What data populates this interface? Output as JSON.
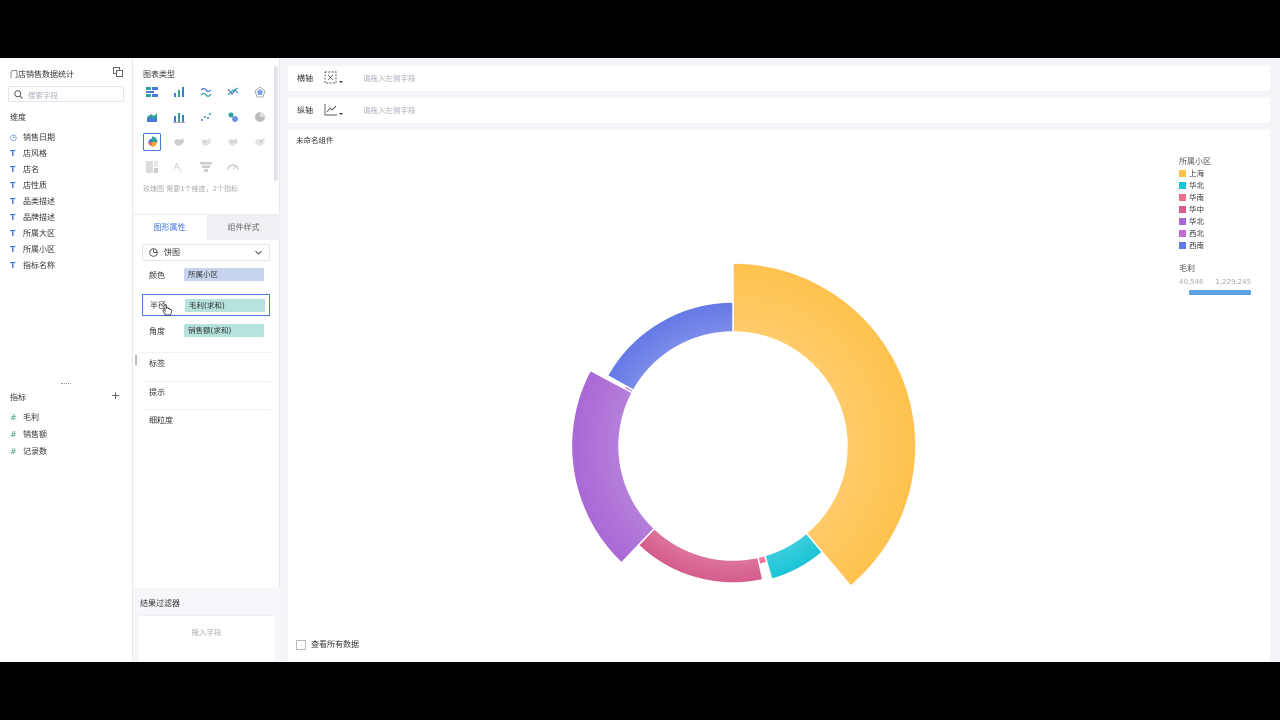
{
  "fields_panel": {
    "dataset_title": "门店销售数据统计",
    "search_placeholder": "搜索字段",
    "dimensions_title": "维度",
    "dimensions": [
      {
        "icon": "date-icon",
        "label": "销售日期"
      },
      {
        "icon": "text-field-icon",
        "label": "店风格"
      },
      {
        "icon": "text-field-icon",
        "label": "店名"
      },
      {
        "icon": "text-field-icon",
        "label": "店性质"
      },
      {
        "icon": "text-field-icon",
        "label": "品类描述"
      },
      {
        "icon": "text-field-icon",
        "label": "品牌描述"
      },
      {
        "icon": "text-field-icon",
        "label": "所属大区"
      },
      {
        "icon": "text-field-icon",
        "label": "所属小区"
      },
      {
        "icon": "text-field-icon",
        "label": "指标名称"
      }
    ],
    "measures_title": "指标",
    "measures": [
      {
        "icon": "number-field-icon",
        "label": "毛利"
      },
      {
        "icon": "number-field-icon",
        "label": "销售额"
      },
      {
        "icon": "number-field-icon",
        "label": "记录数"
      }
    ]
  },
  "config_panel": {
    "chart_type_title": "图表类型",
    "chart_type_hint": "玫瑰图 需要1个维度，2个指标",
    "tabs": {
      "active": "图形属性",
      "inactive": "组件样式"
    },
    "chart_select": "饼图",
    "props": {
      "color_label": "颜色",
      "color_value": "所属小区",
      "radius_label": "半径",
      "radius_value": "毛利(求和)",
      "angle_label": "角度",
      "angle_value": "销售额(求和)",
      "label_label": "标签",
      "tooltip_label": "提示",
      "detail_label": "细粒度"
    },
    "filter_title": "结果过滤器",
    "filter_placeholder": "拖入字段"
  },
  "axis": {
    "horizontal_label": "横轴",
    "vertical_label": "纵轴",
    "placeholder": "请拖入左侧字段"
  },
  "chart": {
    "title": "未命名组件",
    "legend_title": "所属小区",
    "size_legend_title": "毛利",
    "size_min": "40,546",
    "size_max": "1,229,245",
    "view_all_label": "查看所有数据",
    "size_color": "#5ba3e6"
  },
  "chart_data": {
    "type": "pie",
    "variant": "rose-donut",
    "color_field": "所属小区",
    "angle_field": "销售额(求和)",
    "radius_field": "毛利(求和)",
    "slices": [
      {
        "name": "上海",
        "color": "#ffc24e",
        "angle_share": 0.311,
        "radius_share": 1.0
      },
      {
        "name": "华北",
        "color": "#19c4d6",
        "angle_share": 0.053,
        "radius_share": 0.3
      },
      {
        "name": "华南",
        "color": "#ee6f8e",
        "angle_share": 0.008,
        "radius_share": 0.02
      },
      {
        "name": "华中",
        "color": "#d55c8c",
        "angle_share": 0.125,
        "radius_share": 0.27
      },
      {
        "name": "华北",
        "color": "#a968d4",
        "angle_share": 0.165,
        "radius_share": 0.66
      },
      {
        "name": "西北",
        "color": "#c06ad6",
        "angle_share": 0.003,
        "radius_share": 0.05
      },
      {
        "name": "西南",
        "color": "#6478e6",
        "angle_share": 0.135,
        "radius_share": 0.38
      }
    ]
  }
}
